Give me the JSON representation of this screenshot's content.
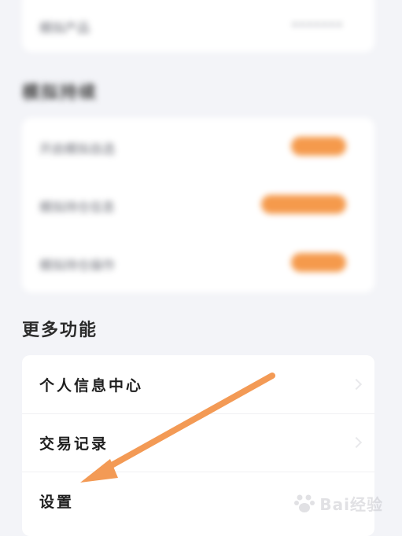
{
  "top_card": {
    "label": "模拟产品",
    "value": "•••••••"
  },
  "section1": {
    "title": "模拟持续",
    "items": [
      {
        "label": "开启模拟自选",
        "button_label": ""
      },
      {
        "label": "模拟持仓信息",
        "button_label": ""
      },
      {
        "label": "模拟持仓操作",
        "button_label": ""
      }
    ]
  },
  "section2": {
    "title": "更多功能",
    "items": [
      {
        "label": "个人信息中心"
      },
      {
        "label": "交易记录"
      },
      {
        "label": "设置"
      }
    ]
  },
  "annotation": {
    "arrow_color": "#f39a55"
  },
  "watermark": {
    "text": "Bai经验"
  },
  "colors": {
    "accent": "#f59a4c",
    "background": "#f3f4f8"
  }
}
